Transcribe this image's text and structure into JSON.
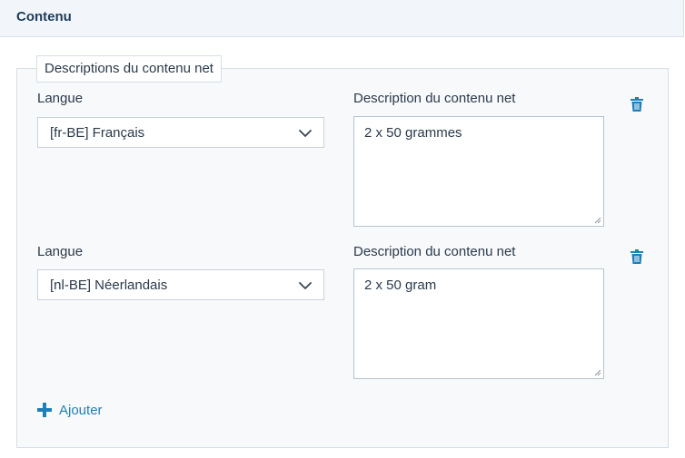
{
  "section": {
    "title": "Contenu"
  },
  "fieldset": {
    "legend": "Descriptions du contenu net",
    "rows": [
      {
        "language_label": "Langue",
        "language_value": "[fr-BE] Français",
        "description_label": "Description du contenu net",
        "description_value": "2 x 50 grammes"
      },
      {
        "language_label": "Langue",
        "language_value": "[nl-BE] Néerlandais",
        "description_label": "Description du contenu net",
        "description_value": "2 x 50 gram"
      }
    ],
    "add_label": "Ajouter"
  },
  "colors": {
    "accent": "#1f7fb8",
    "text": "#2b3a4a",
    "header_bg": "#f2f6fa",
    "panel_bg": "#f7f9fb"
  },
  "icons": {
    "delete": "trash-icon",
    "dropdown": "chevron-down-icon",
    "add": "plus-icon"
  }
}
